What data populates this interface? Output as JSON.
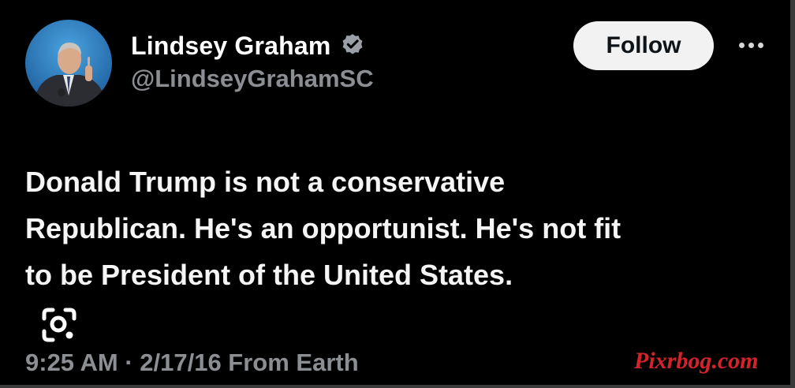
{
  "tweet": {
    "author": {
      "name": "Lindsey Graham",
      "handle": "@LindseyGrahamSC",
      "verified": true
    },
    "follow_label": "Follow",
    "more_icon": "more-options-icon",
    "text_lines": [
      "Donald Trump is not a conservative",
      "Republican. He's an opportunist. He's not fit",
      "to be President of the United States."
    ],
    "meta": "9:25 AM · 2/17/16 From Earth"
  },
  "overlay": {
    "lens_icon": "google-lens-icon",
    "watermark": "Pixrbog.com"
  },
  "colors": {
    "background": "#000000",
    "text": "#f5f5f5",
    "secondary_text": "#8b8f94",
    "verified_badge": "#9aa0a6",
    "follow_button_bg": "#f2f2f2",
    "watermark": "#d4232b"
  }
}
